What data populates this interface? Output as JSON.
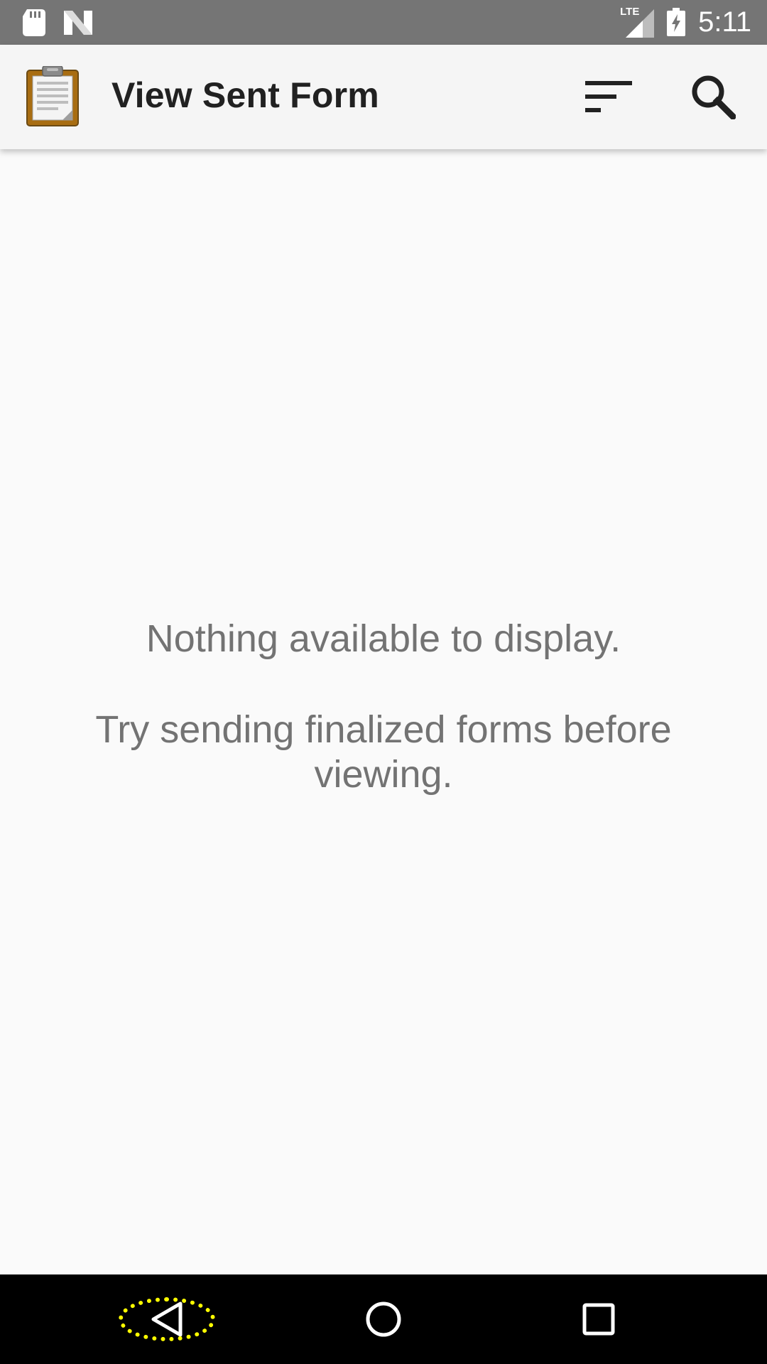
{
  "status_bar": {
    "time": "5:11",
    "network_label": "LTE",
    "icons": [
      "sd-card-icon",
      "n-logo-icon",
      "lte-signal-icon",
      "battery-charging-icon"
    ]
  },
  "app_bar": {
    "title": "View Sent Form",
    "logo_icon": "clipboard-icon",
    "actions": [
      "sort-icon",
      "search-icon"
    ]
  },
  "empty_state": {
    "line1": "Nothing available to display.",
    "line2": "Try sending finalized forms before viewing."
  },
  "nav_bar": {
    "buttons": [
      "back-icon",
      "home-icon",
      "recents-icon"
    ],
    "highlight_color": "#ffff00"
  },
  "colors": {
    "status_bar": "#757575",
    "app_bar": "#f5f5f5",
    "background": "#fafafa",
    "title": "#212121",
    "message": "#737373",
    "nav_bar": "#000000"
  }
}
